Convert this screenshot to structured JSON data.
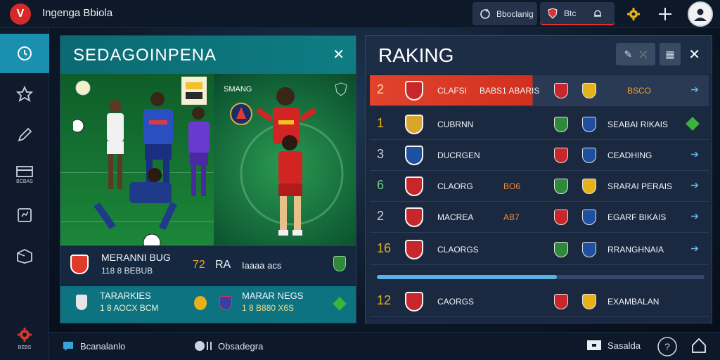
{
  "header": {
    "logo_glyph": "V",
    "app_title": "Ingenga Bbiola",
    "buttons": [
      {
        "icon": "refresh-icon",
        "label": "Bboclanig"
      },
      {
        "icon": "shield-icon",
        "label": "Btc",
        "extra_icon": "bell-icon"
      }
    ],
    "icons": [
      "gear-icon",
      "crosshair-icon",
      "user-avatar"
    ]
  },
  "sidebar": {
    "items": [
      {
        "icon": "clock-icon",
        "label": "",
        "active": true
      },
      {
        "icon": "star-icon",
        "label": ""
      },
      {
        "icon": "pencil-icon",
        "label": ""
      },
      {
        "icon": "card-icon",
        "label": "BCBAS"
      },
      {
        "icon": "chart-icon",
        "label": ""
      },
      {
        "icon": "box-icon",
        "label": ""
      },
      {
        "icon": "settings-icon",
        "label": "BEBS"
      }
    ]
  },
  "left_panel": {
    "title": "SEDAGOINPENA",
    "close_glyph": "✕",
    "card_b_label": "SMANG",
    "row1": {
      "title": "MERANNI BUG",
      "sub": "118 8 BEBUB",
      "score_a": "72",
      "score_b": "RA",
      "right_text": "Iaaaa acs"
    },
    "row2": {
      "title": "TARARKIES",
      "sub": "1 8 AOCX BCM",
      "right_title": "MARAR NEGS",
      "right_sub": "1 8 B880 X6S"
    }
  },
  "right_panel": {
    "title": "RAKING",
    "close_glyph": "✕",
    "rows": [
      {
        "rank": "2",
        "team": "CLAFSI",
        "mid": "BABS1 ABARIS",
        "right": "BSCO",
        "highlight": true,
        "crest_color": "#c8262b",
        "marker": "arrow"
      },
      {
        "rank": "1",
        "team": "CUBRNN",
        "mid": "",
        "right": "SEABAI RIKAIS",
        "crest_color": "#d8a62a",
        "marker": "diamond"
      },
      {
        "rank": "3",
        "team": "DUCRGEN",
        "mid": "",
        "right": "CEADHING",
        "crest_color": "#1e4fa0",
        "marker": "arrow"
      },
      {
        "rank": "6",
        "team": "CLAORG",
        "mid": "BO6",
        "right": "SRARAI PERAIS",
        "crest_color": "#c8262b",
        "marker": "arrow"
      },
      {
        "rank": "2",
        "team": "MACREA",
        "mid": "AB7",
        "right": "EGARF BIKAIS",
        "crest_color": "#c8262b",
        "marker": "arrow"
      },
      {
        "rank": "16",
        "team": "CLAORGS",
        "mid": "",
        "right": "RRANGHNAIA",
        "crest_color": "#c8262b",
        "marker": "arrow"
      },
      {
        "rank": "12",
        "team": "CAORGS",
        "mid": "",
        "right": "EXAMBALAN",
        "crest_color": "#c8262b",
        "marker": "none"
      }
    ],
    "progress": 0.55
  },
  "bottombar": {
    "item1": "Bcanalanlo",
    "item2": "Obsadegra",
    "item3": "Sasalda"
  },
  "colors": {
    "accent_teal": "#0f7c83",
    "accent_red": "#e0432c",
    "accent_blue": "#5ab3e6"
  }
}
